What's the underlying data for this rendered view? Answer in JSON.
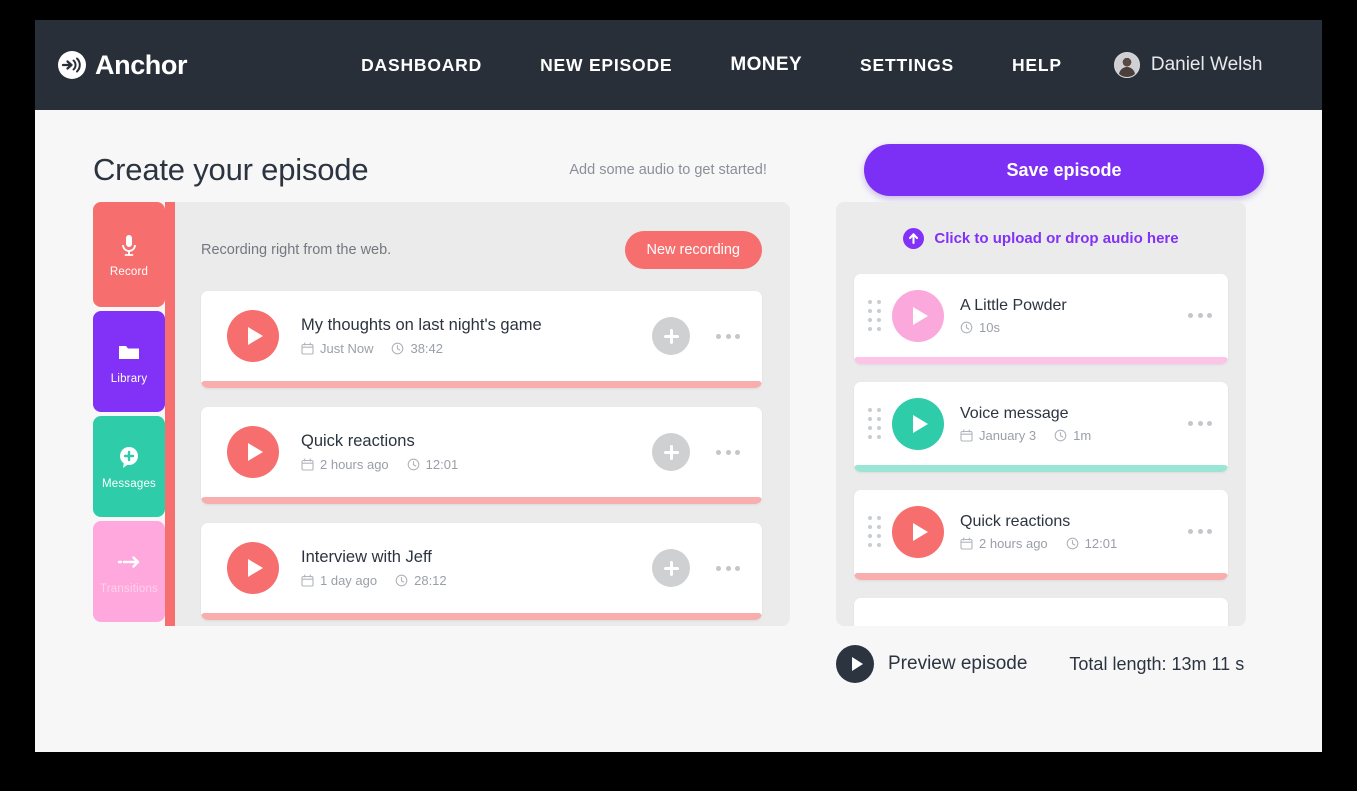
{
  "brand": {
    "name": "Anchor",
    "logo_icon": "anchor-logo-icon"
  },
  "nav": {
    "items": [
      {
        "label": "DASHBOARD",
        "name": "nav-dashboard"
      },
      {
        "label": "NEW EPISODE",
        "name": "nav-new-episode"
      },
      {
        "label": "MONEY",
        "name": "nav-money"
      },
      {
        "label": "SETTINGS",
        "name": "nav-settings"
      },
      {
        "label": "HELP",
        "name": "nav-help"
      }
    ],
    "user": {
      "name": "Daniel Welsh",
      "avatar_icon": "user-avatar"
    }
  },
  "page": {
    "title": "Create your episode",
    "subtitle": "Add some audio to get started!",
    "save_label": "Save episode"
  },
  "colors": {
    "header_bg": "#282F39",
    "page_bg": "#F7F7F8",
    "panel_bg": "#EBEBEB",
    "record_red": "#F76E6E",
    "library_purple": "#8132F6",
    "messages_teal": "#2ECCA8",
    "transitions_pink": "#FFA8DD",
    "save_purple": "#7C30F5",
    "text_dark": "#2C3440",
    "text_muted": "#9A9FA7"
  },
  "sidebar": {
    "tabs": [
      {
        "label": "Record",
        "icon": "microphone-icon",
        "active": true
      },
      {
        "label": "Library",
        "icon": "folder-icon",
        "active": false
      },
      {
        "label": "Messages",
        "icon": "message-plus-icon",
        "active": false
      },
      {
        "label": "Transitions",
        "icon": "dashed-arrow-icon",
        "active": false
      }
    ]
  },
  "recordings": {
    "header_text": "Recording right from the web.",
    "new_recording_label": "New recording",
    "items": [
      {
        "title": "My thoughts on last night's game",
        "date": "Just Now",
        "duration": "38:42"
      },
      {
        "title": "Quick reactions",
        "date": "2 hours ago",
        "duration": "12:01"
      },
      {
        "title": "Interview with Jeff",
        "date": "1 day ago",
        "duration": "28:12"
      }
    ]
  },
  "episode": {
    "upload_label": "Click to upload or drop audio here",
    "upload_icon": "upload-arrow-icon",
    "items": [
      {
        "title": "A Little Powder",
        "date": "",
        "duration": "10s",
        "color": "pink"
      },
      {
        "title": "Voice message",
        "date": "January 3",
        "duration": "1m",
        "color": "teal"
      },
      {
        "title": "Quick reactions",
        "date": "2 hours ago",
        "duration": "12:01",
        "color": "red"
      }
    ]
  },
  "footer": {
    "preview_label": "Preview episode",
    "total_length": "Total length: 13m 11 s"
  }
}
